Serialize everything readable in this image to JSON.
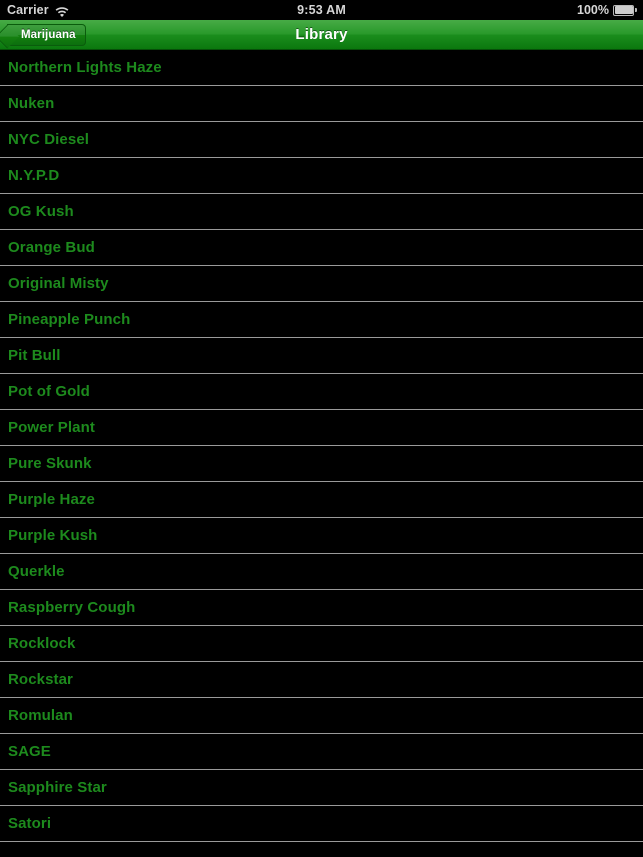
{
  "statusbar": {
    "carrier": "Carrier",
    "wifi_icon": "wifi-icon",
    "time": "9:53 AM",
    "battery_percent": "100%",
    "battery_icon": "battery-full-icon"
  },
  "navbar": {
    "title": "Library",
    "back_label": "Marijuana",
    "back_icon": "chevron-left-icon"
  },
  "colors": {
    "nav_green_top": "#47ab46",
    "nav_green_bottom": "#0b780e",
    "row_text_green": "#1d8a1d",
    "row_background": "#000000",
    "separator": "#9a9a9a",
    "status_text": "#d6d6d6"
  },
  "list": {
    "items": [
      {
        "label": "Northern Lights Haze"
      },
      {
        "label": "Nuken"
      },
      {
        "label": "NYC Diesel"
      },
      {
        "label": "N.Y.P.D"
      },
      {
        "label": "OG Kush"
      },
      {
        "label": "Orange Bud"
      },
      {
        "label": "Original Misty"
      },
      {
        "label": "Pineapple Punch"
      },
      {
        "label": "Pit Bull"
      },
      {
        "label": "Pot of Gold"
      },
      {
        "label": "Power Plant"
      },
      {
        "label": "Pure Skunk"
      },
      {
        "label": "Purple Haze"
      },
      {
        "label": "Purple Kush"
      },
      {
        "label": "Querkle"
      },
      {
        "label": "Raspberry Cough"
      },
      {
        "label": "Rocklock"
      },
      {
        "label": "Rockstar"
      },
      {
        "label": "Romulan"
      },
      {
        "label": "SAGE"
      },
      {
        "label": "Sapphire Star"
      },
      {
        "label": "Satori"
      }
    ]
  }
}
